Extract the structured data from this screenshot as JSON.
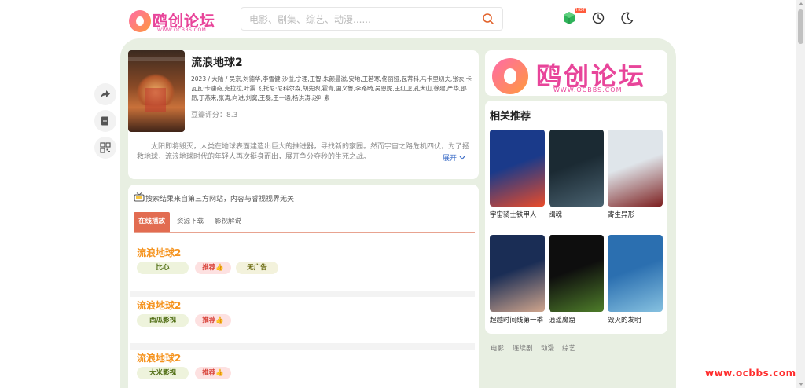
{
  "header": {
    "logo_text": "鸥创论坛",
    "logo_sub": "WWW.OCBBS.COM",
    "search_placeholder": "电影、剧集、综艺、动漫......",
    "hot_badge": "HOT"
  },
  "movie": {
    "title": "流浪地球2",
    "meta": "2023 / 大陆 / 吴京,刘德华,李雪健,沙溢,宁理,王智,朱颜曼滋,安地,王若寒,佟丽娅,瓦蒂科,马卡里切夫,张衣,卡瓦瓦·卡迪奇,克拉拉,叶震飞,托尼·尼科尔森,胡先煦,霍青,国义鲁,李路畸,吴恩妮,王红卫,孔大山,徐建,严华,邵昂,丁燕来,张涛,向进,刘寞,王磊,王一通,杨洪涛,赵叶素",
    "score": "豆瓣评分：8.3",
    "desc": "太阳即将毁灭，人类在地球表面建造出巨大的推进器，寻找新的家园。然而宇宙之路危机四伏，为了拯救地球，流浪地球时代的年轻人再次挺身而出，展开争分夺秒的生死之战。",
    "expand": "展开"
  },
  "sources": {
    "notice": "搜索结果来自第三方网站，内容与睿视视界无关",
    "tabs": [
      "在线播放",
      "资源下载",
      "影视解说"
    ],
    "items": [
      {
        "title": "流浪地球2",
        "site": "比心",
        "rec": "推荐👍",
        "extra": "无广告"
      },
      {
        "title": "流浪地球2",
        "site": "西瓜影视",
        "rec": "推荐👍"
      },
      {
        "title": "流浪地球2",
        "site": "大米影视",
        "rec": "推荐👍"
      }
    ]
  },
  "sidebar": {
    "brand_text": "鸥创论坛",
    "brand_sub": "WWW.OCBBS.COM",
    "related_title": "相关推荐",
    "related": [
      {
        "name": "宇宙骑士铁甲人",
        "color1": "#1a3a8a",
        "color2": "#e94b2a"
      },
      {
        "name": "缉魂",
        "color1": "#1b2a33",
        "color2": "#4a6270"
      },
      {
        "name": "寄生异形",
        "color1": "#dfe5ea",
        "color2": "#7d2020"
      },
      {
        "name": "超越时间线第一季",
        "color1": "#1a2d55",
        "color2": "#d0a58c"
      },
      {
        "name": "逍遥魔窟",
        "color1": "#0e0e0e",
        "color2": "#4e7d2a"
      },
      {
        "name": "毁灭的发明",
        "color1": "#2b6fb0",
        "color2": "#86c1e0"
      }
    ],
    "categories": [
      "电影",
      "连续剧",
      "动漫",
      "综艺"
    ]
  },
  "watermark": "www.ocbbs.com"
}
